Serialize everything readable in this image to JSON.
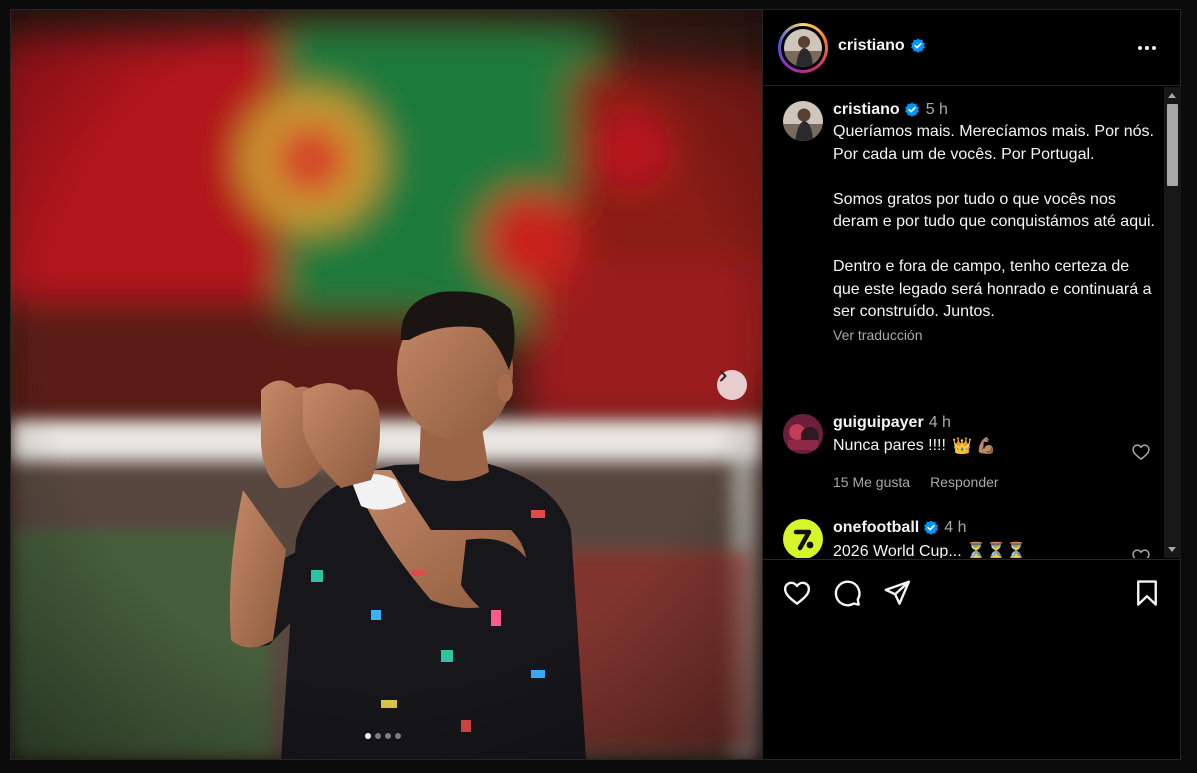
{
  "post": {
    "carousel": {
      "total": 4,
      "active": 0
    },
    "icons": {
      "next": "chevron-right-icon"
    }
  },
  "header": {
    "username": "cristiano",
    "verified_icon": "verified-badge-icon",
    "more_icon": "more-options-icon"
  },
  "caption": {
    "username": "cristiano",
    "time": "5 h",
    "paragraphs": [
      "Queríamos mais. Merecíamos mais. Por nós. Por cada um de vocês. Por Portugal.",
      "Somos gratos por tudo o que vocês nos deram e por tudo que conquistámos até aqui.",
      "Dentro e fora de campo, tenho certeza de que este legado será honrado e continuará a ser construído. Juntos."
    ],
    "translate_label": "Ver traducción"
  },
  "comments": [
    {
      "username": "guiguipayer",
      "time": "4 h",
      "text": "Nunca pares !!!!",
      "emojis": "👑 💪🏽",
      "likes": "15 Me gusta",
      "reply": "Responder"
    },
    {
      "username": "onefootball",
      "time": "4 h",
      "text": "2026 World Cup... ⏳⏳⏳",
      "verified": true
    }
  ],
  "actions": {
    "like_icon": "heart-icon",
    "comment_icon": "comment-icon",
    "share_icon": "share-icon",
    "save_icon": "bookmark-icon"
  },
  "colors": {
    "background": "#000000",
    "text": "#f5f5f5",
    "muted": "#a8a8a8",
    "verified": "#0095f6",
    "border": "#262626"
  }
}
